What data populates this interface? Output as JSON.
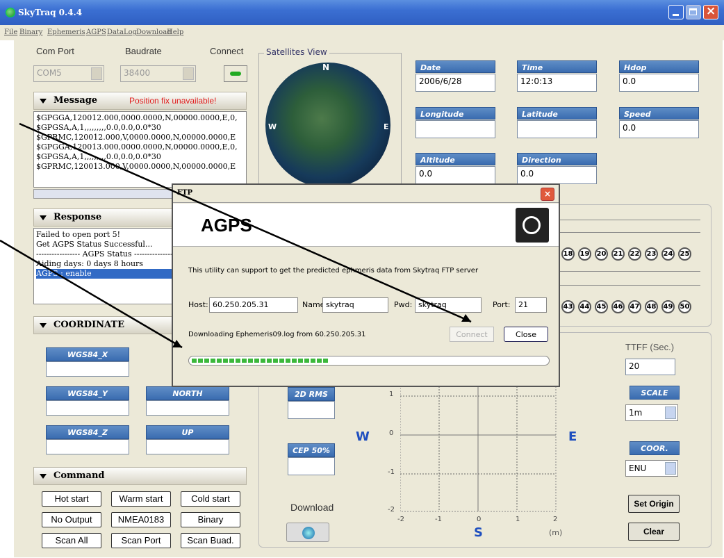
{
  "window": {
    "title": "SkyTraq 0.4.4"
  },
  "menu": [
    "File",
    "Binary",
    "Ephemeris",
    "AGPS",
    "DataLog",
    "Download",
    "Help"
  ],
  "com": {
    "port_label": "Com Port",
    "port_value": "COM5",
    "baud_label": "Baudrate",
    "baud_value": "38400",
    "connect_label": "Connect"
  },
  "message": {
    "header": "Message",
    "status": "Position fix unavailable!",
    "lines": "$GPGGA,120012.000,0000.0000,N,00000.0000,E,0,\n$GPGSA,A,1,,,,,,,,,0.0,0.0,0.0*30\n$GPRMC,120012.000,V,0000.0000,N,00000.0000,E\n$GPGGA,120013.000,0000.0000,N,00000.0000,E,0,\n$GPGSA,A,1,,,,,,,,,0.0,0.0,0.0*30\n$GPRMC,120013.000,V,0000.0000,N,00000.0000,E"
  },
  "response": {
    "header": "Response",
    "lines": [
      "Failed to open port 5!",
      "Get AGPS Status Successful...",
      "----------------- AGPS Status -----------------",
      "Aiding days: 0 days 8 hours",
      "AGPS : enable"
    ]
  },
  "coordinate": {
    "header": "COORDINATE",
    "labels": [
      "WGS84_X",
      "WGS84_Y",
      "NORTH",
      "WGS84_Z",
      "UP"
    ]
  },
  "command": {
    "header": "Command",
    "buttons": [
      "Hot start",
      "Warm start",
      "Cold start",
      "No Output",
      "NMEA0183",
      "Binary",
      "Scan All",
      "Scan Port",
      "Scan Buad."
    ]
  },
  "satellites": {
    "title": "Satellites View",
    "n": "N",
    "w": "W",
    "e": "E",
    "row1": [
      "18",
      "19",
      "20",
      "21",
      "22",
      "23",
      "24",
      "25"
    ],
    "row2": [
      "43",
      "44",
      "45",
      "46",
      "47",
      "48",
      "49",
      "50"
    ]
  },
  "fields": {
    "date_label": "Date",
    "date_value": "2006/6/28",
    "time_label": "Time",
    "time_value": "12:0:13",
    "hdop_label": "Hdop",
    "hdop_value": "0.0",
    "lon_label": "Longitude",
    "lat_label": "Latitude",
    "speed_label": "Speed",
    "speed_value": "0.0",
    "alt_label": "Altitude",
    "alt_value": "0.0",
    "dir_label": "Direction",
    "dir_value": "0.0"
  },
  "scatter": {
    "rms_label": "2D RMS",
    "cep_label": "CEP 50%",
    "w": "W",
    "e": "E",
    "s": "S",
    "unit": "(m)",
    "yticks": [
      "1",
      "0",
      "-1",
      "-2"
    ],
    "xticks": [
      "-2",
      "-1",
      "0",
      "1",
      "2"
    ],
    "download_label": "Download"
  },
  "right_panel": {
    "ttff_label": "TTFF (Sec.)",
    "ttff_value": "20",
    "scale_label": "SCALE",
    "scale_value": "1m",
    "coor_label": "COOR.",
    "coor_value": "ENU",
    "set_origin": "Set Origin",
    "clear": "Clear"
  },
  "ftp": {
    "title": "FTP",
    "heading": "AGPS",
    "description": "This utility can support to get  the predicted ephmeris  data from Skytraq FTP server",
    "host_label": "Host:",
    "host_value": "60.250.205.31",
    "name_label": "Name:",
    "name_value": "skytraq",
    "pwd_label": "Pwd:",
    "pwd_value": "skytraq",
    "port_label": "Port:",
    "port_value": "21",
    "status": "Downloading Ephemeris09.log from 60.250.205.31",
    "connect": "Connect",
    "close": "Close",
    "progress": 0.38
  }
}
